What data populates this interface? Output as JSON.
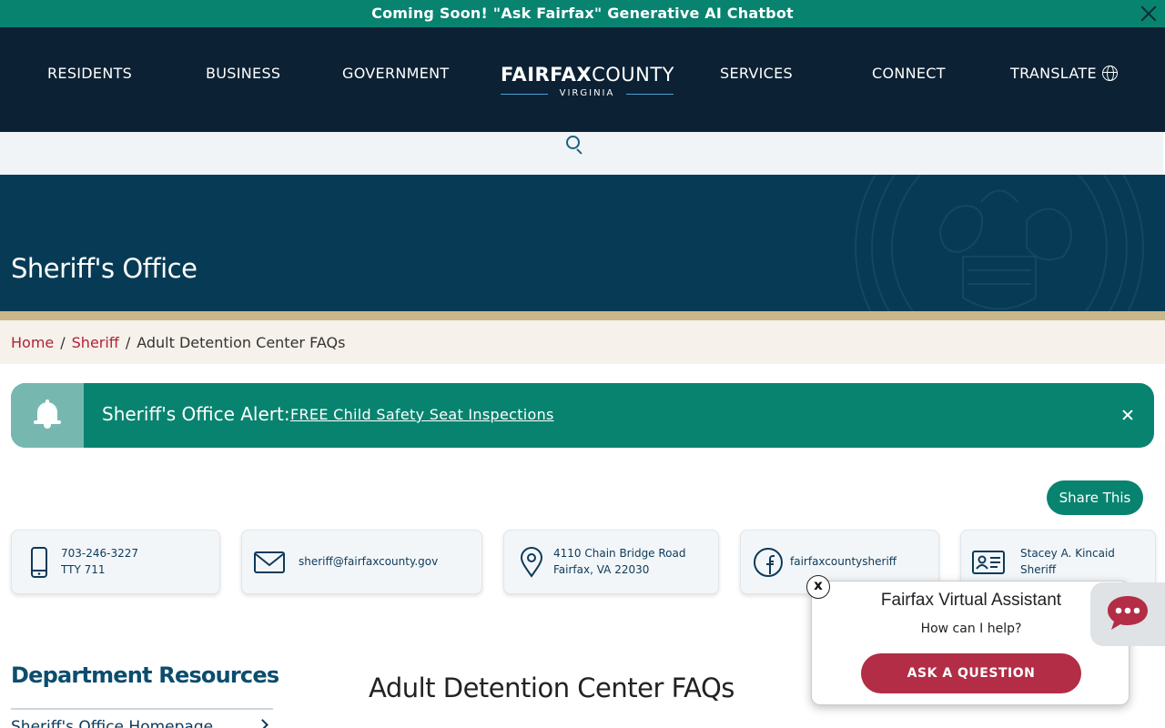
{
  "banner": {
    "text": "Coming Soon! \"Ask Fairfax\" Generative AI Chatbot"
  },
  "nav": {
    "items": [
      "RESIDENTS",
      "BUSINESS",
      "GOVERNMENT",
      "SERVICES",
      "CONNECT",
      "TRANSLATE"
    ],
    "logo": {
      "fairfax": "FAIRFAX",
      "county": "COUNTY",
      "state": "VIRGINIA"
    }
  },
  "hero": {
    "title": "Sheriff's Office"
  },
  "breadcrumb": {
    "home": "Home",
    "section": "Sheriff",
    "current": "Adult Detention Center FAQs"
  },
  "alert": {
    "label": "Sheriff's Office Alert:",
    "link": "FREE Child Safety Seat Inspections"
  },
  "share": {
    "label": "Share This"
  },
  "contacts": {
    "phone": {
      "line1": "703-246-3227",
      "line2": "TTY 711"
    },
    "email": {
      "line1": "sheriff@fairfaxcounty.gov"
    },
    "address": {
      "line1": "4110 Chain Bridge Road",
      "line2": "Fairfax, VA 22030"
    },
    "facebook": {
      "line1": "fairfaxcountysheriff"
    },
    "person": {
      "line1": "Stacey A. Kincaid",
      "line2": "Sheriff"
    }
  },
  "assistant": {
    "close": "x",
    "title": "Fairfax Virtual Assistant",
    "subtitle": "How can I help?",
    "button": "ASK A QUESTION"
  },
  "sidebar": {
    "heading": "Department Resources",
    "first_link": "Sheriff's Office Homepage"
  },
  "page": {
    "title": "Adult Detention Center FAQs"
  },
  "colors": {
    "teal": "#08836f",
    "navy": "#0c2133",
    "hero": "#073b55",
    "crimson": "#b22234"
  }
}
